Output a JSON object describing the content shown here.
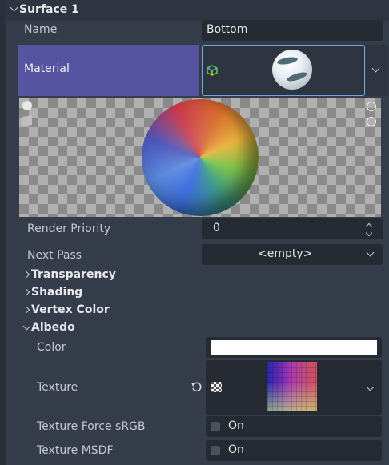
{
  "section": {
    "title": "Surface 1"
  },
  "name_row": {
    "label": "Name",
    "value": "Bottom"
  },
  "material_row": {
    "label": "Material"
  },
  "render_priority": {
    "label": "Render Priority",
    "value": "0"
  },
  "next_pass": {
    "label": "Next Pass",
    "value": "<empty>"
  },
  "groups": [
    {
      "label": "Transparency",
      "expanded": false
    },
    {
      "label": "Shading",
      "expanded": false
    },
    {
      "label": "Vertex Color",
      "expanded": false
    },
    {
      "label": "Albedo",
      "expanded": true
    }
  ],
  "albedo": {
    "color_label": "Color",
    "color_value": "#ffffff",
    "texture_label": "Texture",
    "force_srgb_label": "Texture Force sRGB",
    "force_srgb_value": "On",
    "msdf_label": "Texture MSDF",
    "msdf_value": "On"
  },
  "icons": {
    "section_chevron": "chevron-down-icon",
    "material_resource": "cube-resource-icon",
    "preview_light": "light-toggle-icon",
    "preview_mesh": "mesh-toggle-icon",
    "preview_light1": "sun-icon",
    "preview_light2": "sun-icon",
    "revert": "revert-icon",
    "texture_resource": "texture-icon"
  },
  "colors": {
    "accent": "#6fa9e0",
    "material_highlight": "#5654a0",
    "panel": "#363d4a"
  }
}
